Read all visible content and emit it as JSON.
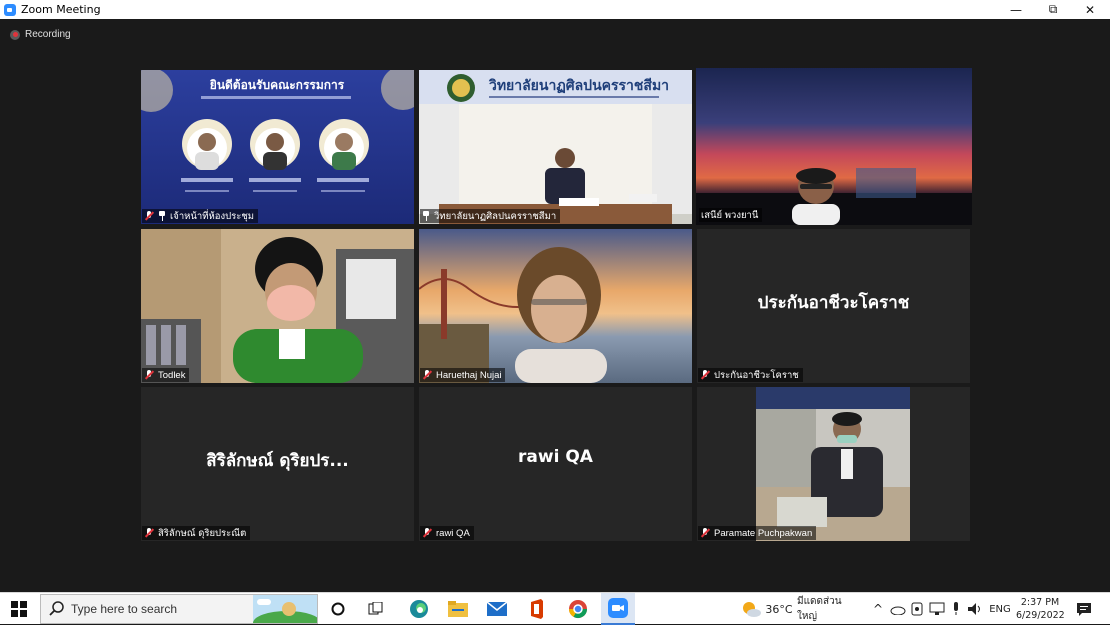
{
  "window": {
    "title": "Zoom Meeting",
    "minimize": "—",
    "restore": "⧉",
    "close": "✕"
  },
  "meeting": {
    "recording_label": "Recording",
    "tiles": [
      {
        "name": "เจ้าหน้าที่ห้องประชุม",
        "status": "pinned",
        "slide_title": "ยินดีต้อนรับคณะกรรมการ"
      },
      {
        "name": "วิทยาลัยนาฏศิลปนครราชสีมา",
        "status": "pinned",
        "banner_text": "วิทยาลัยนาฏศิลปนครราชสีมา"
      },
      {
        "name": "เสนีย์ พวงยานี",
        "status": "active-speaker"
      },
      {
        "name": "Todlek",
        "status": "muted"
      },
      {
        "name": "Haruethaj Nujai",
        "status": "muted"
      },
      {
        "name": "ประกันอาชีวะโคราช",
        "status": "muted",
        "display_name": "ประกันอาชีวะโคราช"
      },
      {
        "name": "สิริลักษณ์ ดุริยประณีต",
        "status": "muted",
        "display_name": "สิริลักษณ์ ดุริยปร..."
      },
      {
        "name": "rawi QA",
        "status": "muted",
        "display_name": "rawi QA"
      },
      {
        "name": "Paramate Puchpakwan",
        "status": "muted"
      }
    ]
  },
  "taskbar": {
    "search_placeholder": "Type here to search",
    "weather_temp": "36°C",
    "weather_desc": "มีแดดส่วนใหญ่",
    "language": "ENG",
    "time": "2:37 PM",
    "date": "6/29/2022",
    "icons": [
      "windows-start-icon",
      "search-icon",
      "cortana-icon",
      "task-view-icon",
      "edge-icon",
      "file-explorer-icon",
      "mail-icon",
      "office-icon",
      "chrome-icon",
      "zoom-icon"
    ]
  },
  "colors": {
    "active_speaker_border": "#c7e051",
    "mute_red": "#e0343c",
    "meeting_bg": "#1a1a1a",
    "tile_bg": "#262626"
  }
}
